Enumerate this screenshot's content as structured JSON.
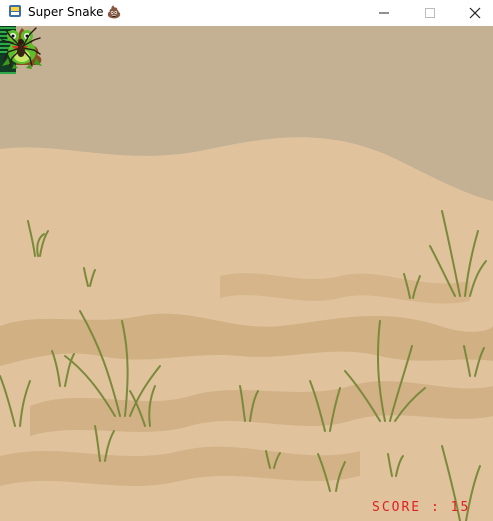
{
  "window": {
    "title": "Super Snake",
    "title_emoji": "💩",
    "minimize_label": "—",
    "maximize_label": "☐",
    "close_label": "✕"
  },
  "game": {
    "score_label": "SCORE : 15",
    "score": 15,
    "colors": {
      "sky": "#c4b093",
      "sand": "#e0c39d",
      "sand_dark": "#c8a475",
      "score": "#e02020",
      "snake_green": "#2fa84a",
      "snake_dark": "#0b3a1e"
    },
    "sprites": {
      "poop": "poop-with-sunglasses-icon",
      "frog": "frog-icon",
      "spider": "spider-icon",
      "snake": "snake-head-icon"
    }
  }
}
